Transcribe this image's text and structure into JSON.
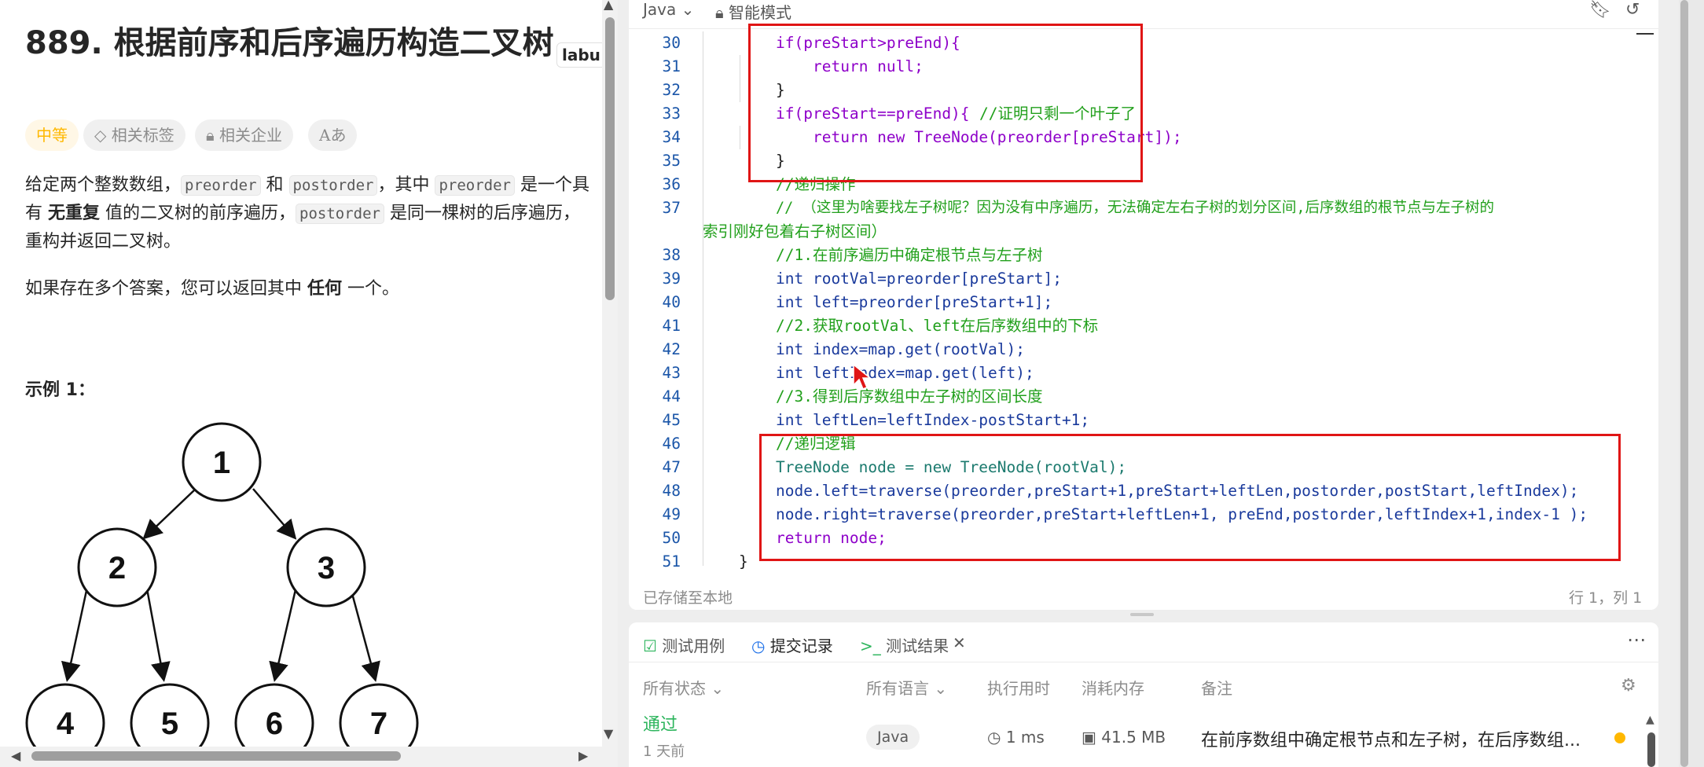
{
  "problem": {
    "title": "889. 根据前序和后序遍历构造二叉树",
    "side_tag": "labu",
    "tags": {
      "difficulty": "中等",
      "related_tags": "相关标签",
      "related_companies": "相关企业",
      "translate": "Aあ"
    },
    "desc_p1_a": "给定两个整数数组，",
    "desc_p1_code1": "preorder",
    "desc_p1_b": " 和 ",
    "desc_p1_code2": "postorder",
    "desc_p1_c": "，其中 ",
    "desc_p1_code3": "preorder",
    "desc_p1_d": " 是一个具有 ",
    "desc_p1_bold": "无重复",
    "desc_p1_e": " 值的二叉树的前序遍历，",
    "desc_p1_code4": "postorder",
    "desc_p1_f": " 是同一棵树的后序遍历，重构并返回二叉树。",
    "desc_p2_a": "如果存在多个答案，您可以返回其中 ",
    "desc_p2_bold": "任何",
    "desc_p2_b": " 一个。",
    "example_title": "示例 1：",
    "tree_nodes": [
      "1",
      "2",
      "3",
      "4",
      "5",
      "6",
      "7"
    ]
  },
  "editor": {
    "language": "Java",
    "mode_label": "智能模式",
    "lines": {
      "l30": "30",
      "l31": "31",
      "l32": "32",
      "l33": "33",
      "l34": "34",
      "l35": "35",
      "l36": "36",
      "l37": "37",
      "l38": "38",
      "l39": "39",
      "l40": "40",
      "l41": "41",
      "l42": "42",
      "l43": "43",
      "l44": "44",
      "l45": "45",
      "l46": "46",
      "l47": "47",
      "l48": "48",
      "l49": "49",
      "l50": "50",
      "l51": "51"
    },
    "code": {
      "c30": "if(preStart>preEnd){",
      "c31": "return null;",
      "c32": "}",
      "c33a": "if(preStart==preEnd){",
      "c33b": "//证明只剩一个叶子了",
      "c34": "return new TreeNode(preorder[preStart]);",
      "c35": "}",
      "c36": "//递归操作",
      "c37a": "// （这里为啥要找左子树呢？因为没有中序遍历，无法确定左右子树的划分区间,后序数组的根节点与左子树的",
      "c37b": "索引刚好包着右子树区间）",
      "c38": "//1.在前序遍历中确定根节点与左子树",
      "c39": "int rootVal=preorder[preStart];",
      "c40": "int left=preorder[preStart+1];",
      "c41": "//2.获取rootVal、left在后序数组中的下标",
      "c42": "int index=map.get(rootVal);",
      "c43": "int leftIndex=map.get(left);",
      "c44": "//3.得到后序数组中左子树的区间长度",
      "c45": "int leftLen=leftIndex-postStart+1;",
      "c46": "//递归逻辑",
      "c47": "TreeNode node = new TreeNode(rootVal);",
      "c48": "node.left=traverse(preorder,preStart+1,preStart+leftLen,postorder,postStart,leftIndex);",
      "c49": "node.right=traverse(preorder,preStart+leftLen+1, preEnd,postorder,leftIndex+1,index-1 );",
      "c50": "return node;",
      "c51": "}"
    },
    "saved_status": "已存储至本地",
    "cursor_position": "行 1，列 1"
  },
  "results": {
    "tabs": {
      "testcase": "测试用例",
      "submissions": "提交记录",
      "test_result": "测试结果"
    },
    "columns": {
      "status": "所有状态",
      "language": "所有语言",
      "runtime": "执行用时",
      "memory": "消耗内存",
      "notes": "备注"
    },
    "row": {
      "status": "通过",
      "time_ago": "1 天前",
      "language": "Java",
      "runtime": "1 ms",
      "memory": "41.5 MB",
      "note": "在前序数组中确定根节点和左子树，在后序数组..."
    }
  },
  "colors": {
    "accent_green": "#2db55d",
    "highlight_red": "#e01515",
    "difficulty_orange": "#ffb800",
    "status_dot": "#ffb800"
  }
}
